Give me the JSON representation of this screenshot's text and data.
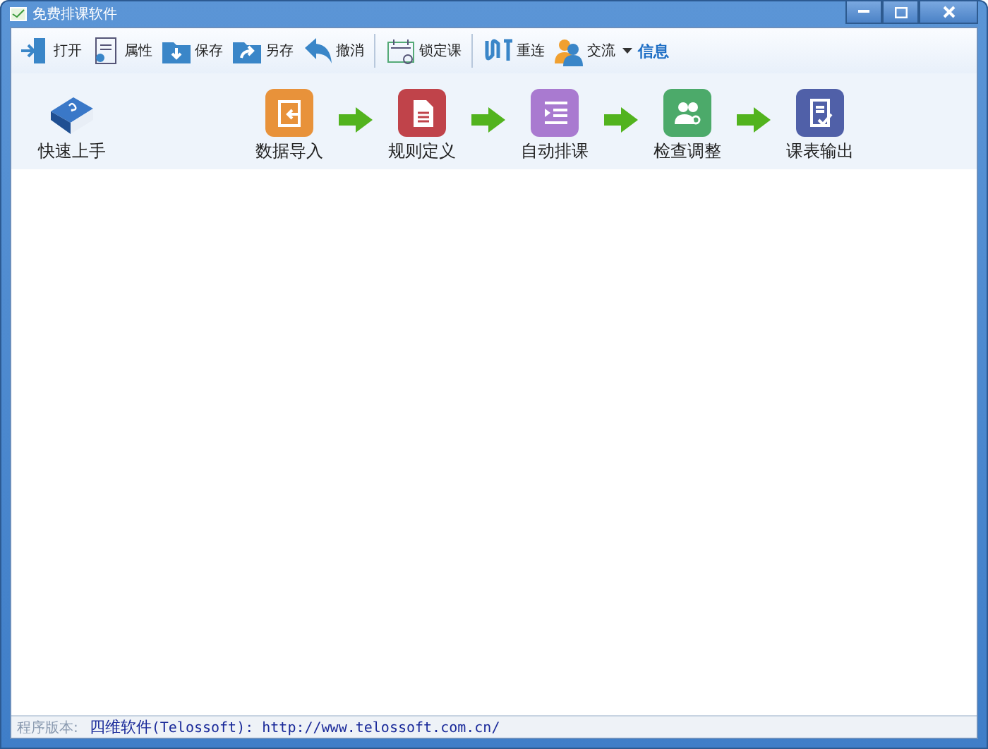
{
  "window": {
    "title": "免费排课软件"
  },
  "toolbar": [
    [
      {
        "kind": "button",
        "label": "打开"
      },
      {
        "kind": "button",
        "label": "属性"
      },
      {
        "kind": "button",
        "label": "保存"
      },
      {
        "kind": "button",
        "label": "另存"
      },
      {
        "kind": "button",
        "label": "撤消"
      }
    ],
    [
      {
        "kind": "button",
        "label": "锁定课"
      }
    ],
    [
      {
        "kind": "button",
        "label": "重连"
      },
      {
        "kind": "dropdown",
        "label": "交流"
      },
      {
        "kind": "link",
        "label": "信息"
      }
    ]
  ],
  "quick_start": {
    "label": "快速上手"
  },
  "workflow": [
    {
      "label": "数据导入",
      "color": "#e8923a"
    },
    {
      "label": "规则定义",
      "color": "#c0434a"
    },
    {
      "label": "自动排课",
      "color": "#a97ad0"
    },
    {
      "label": "检查调整",
      "color": "#4caa6a"
    },
    {
      "label": "课表输出",
      "color": "#5060a8"
    }
  ],
  "status_bar": {
    "label": "程序版本:",
    "company": "四维软件",
    "text": "(Telossoft): http://www.telossoft.com.cn/"
  }
}
